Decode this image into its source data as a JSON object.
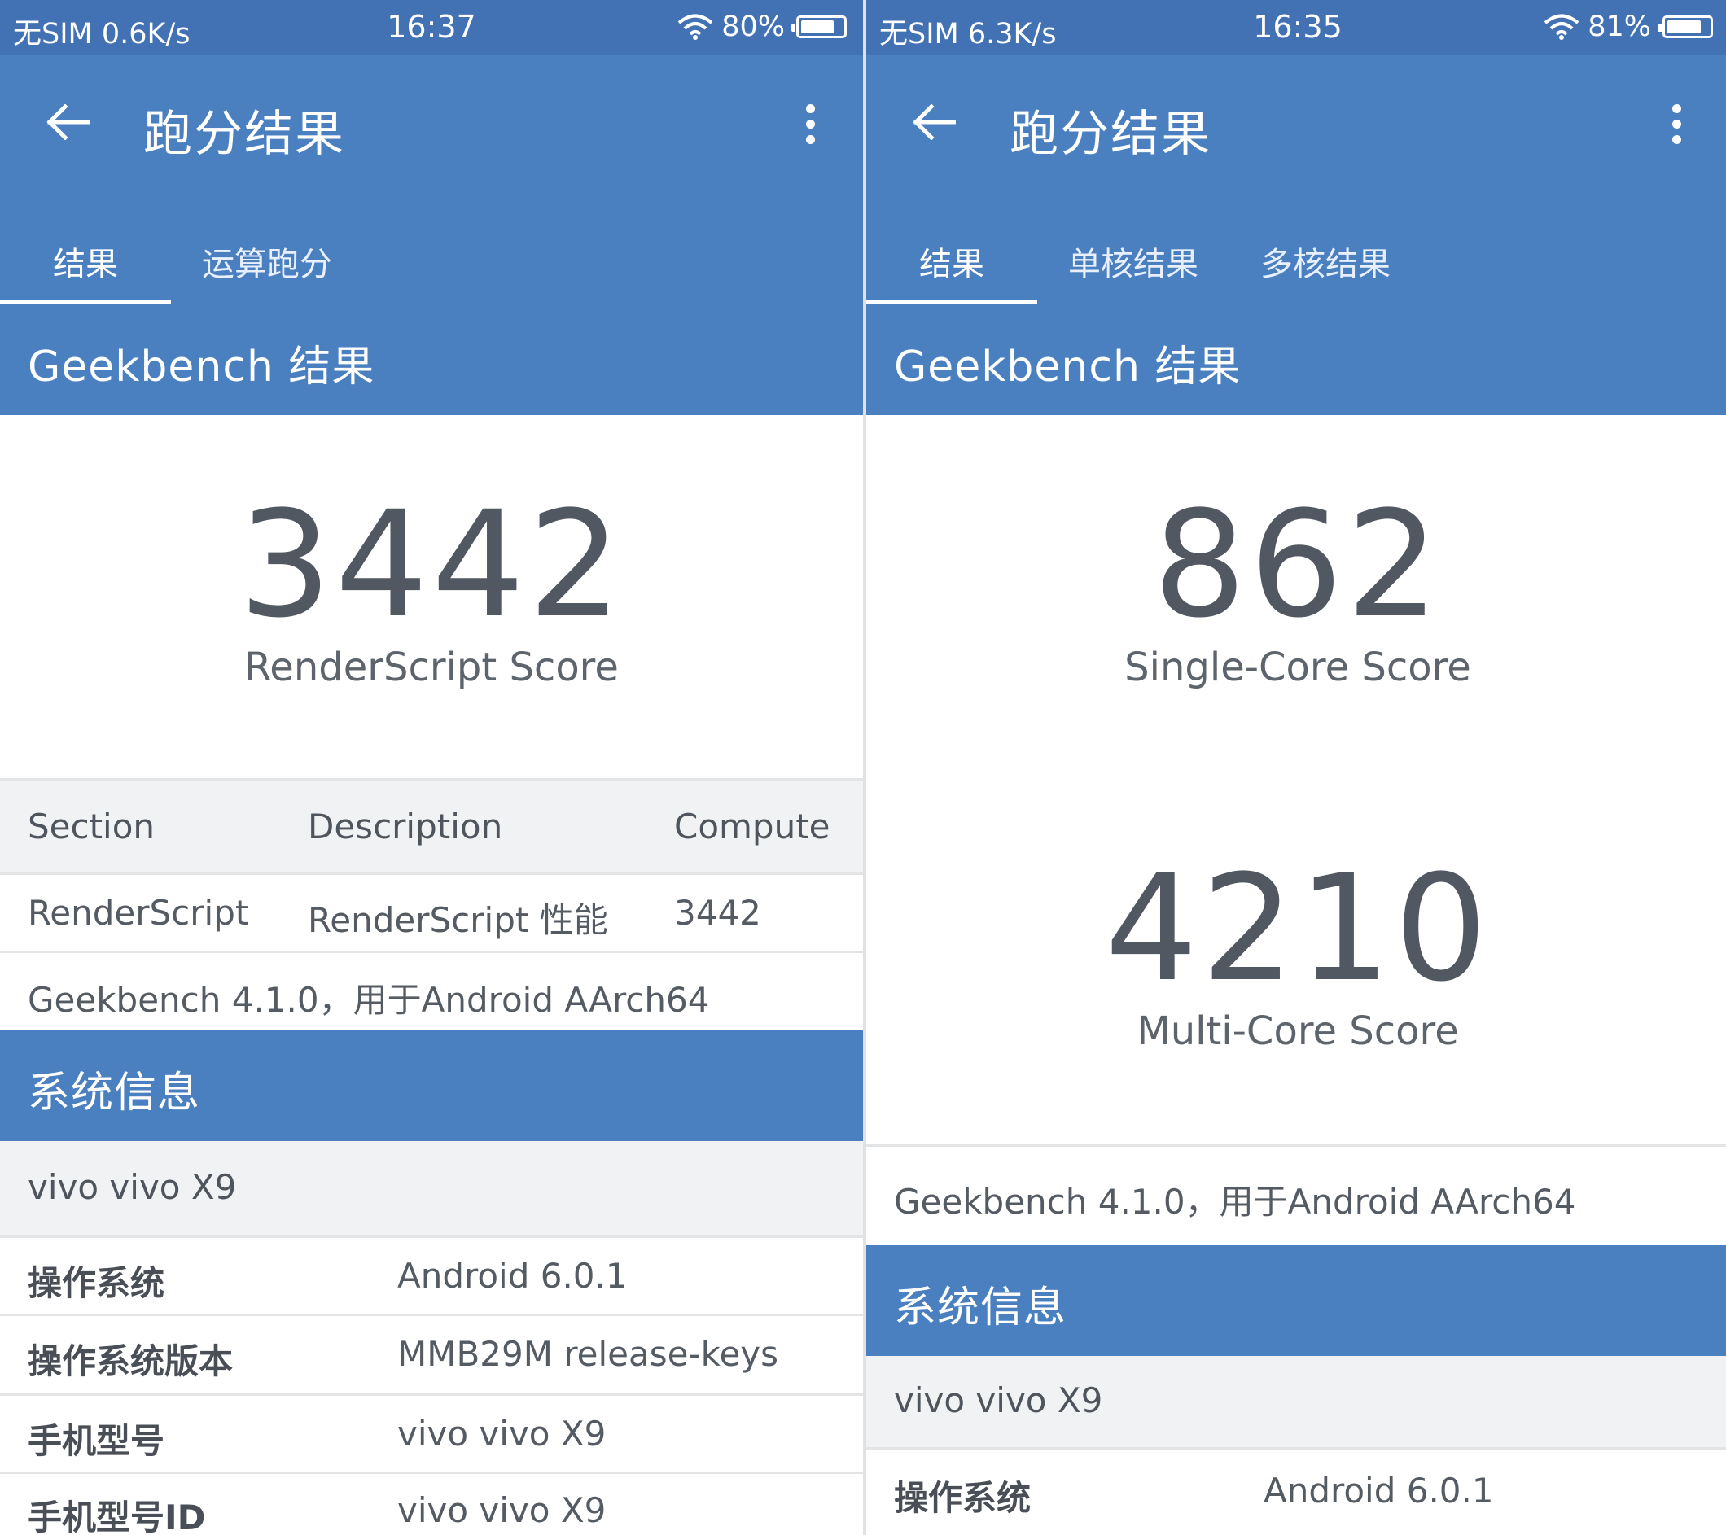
{
  "left": {
    "status": {
      "carrier": "无SIM",
      "speed": "0.6K/s",
      "time": "16:37",
      "battery": "80%",
      "battery_level": 0.8
    },
    "app_title": "跑分结果",
    "tabs": [
      "结果",
      "运算跑分"
    ],
    "section_title": "Geekbench 结果",
    "score": {
      "value": "3442",
      "label": "RenderScript Score"
    },
    "table": {
      "headers": [
        "Section",
        "Description",
        "Compute"
      ],
      "row": [
        "RenderScript",
        "RenderScript 性能",
        "3442"
      ]
    },
    "version": "Geekbench 4.1.0，用于Android AArch64",
    "sysinfo_title": "系统信息",
    "device": "vivo vivo X9",
    "info": [
      {
        "key": "操作系统",
        "value": "Android 6.0.1"
      },
      {
        "key": "操作系统版本",
        "value": "MMB29M release-keys"
      },
      {
        "key": "手机型号",
        "value": "vivo vivo X9"
      },
      {
        "key": "手机型号ID",
        "value": "vivo vivo X9"
      }
    ]
  },
  "right": {
    "status": {
      "carrier": "无SIM",
      "speed": "6.3K/s",
      "time": "16:35",
      "battery": "81%",
      "battery_level": 0.81
    },
    "app_title": "跑分结果",
    "tabs": [
      "结果",
      "单核结果",
      "多核结果"
    ],
    "section_title": "Geekbench 结果",
    "single": {
      "value": "862",
      "label": "Single-Core Score"
    },
    "multi": {
      "value": "4210",
      "label": "Multi-Core Score"
    },
    "version": "Geekbench 4.1.0，用于Android AArch64",
    "sysinfo_title": "系统信息",
    "device": "vivo vivo X9",
    "info": [
      {
        "key": "操作系统",
        "value": "Android 6.0.1"
      }
    ]
  },
  "icons": [
    "back-arrow-icon",
    "more-vert-icon",
    "wifi-icon",
    "battery-icon"
  ],
  "colors": {
    "appbar": "#4a7fc0",
    "statusbar": "#4272b4",
    "text": "#525861"
  }
}
